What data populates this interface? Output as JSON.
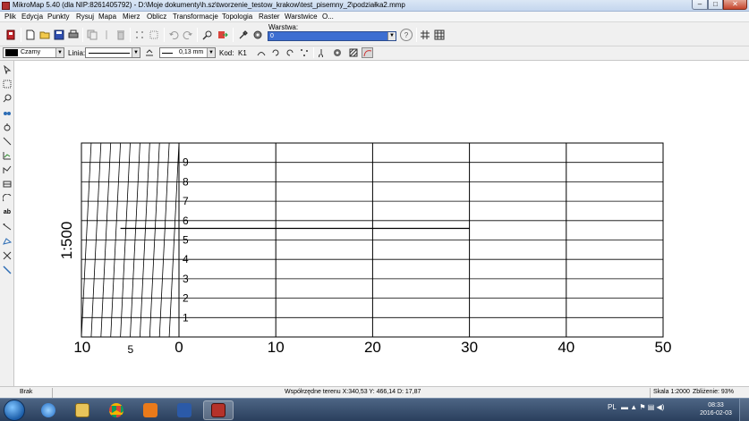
{
  "window": {
    "title": "MikroMap 5.40 (dla NIP:8261405792) - D:\\Moje dokumenty\\h.sz\\tworzenie_testow_krakow\\test_pisemny_2\\podziałka2.mmp",
    "minimize": "–",
    "maximize": "□",
    "close": "✕"
  },
  "menu": [
    "Plik",
    "Edycja",
    "Punkty",
    "Rysuj",
    "Mapa",
    "Mierz",
    "Oblicz",
    "Transformacje",
    "Topologia",
    "Raster",
    "Warstwice",
    "O..."
  ],
  "toolbar": {
    "layer_label": "Warstwa:",
    "layer_value": "0",
    "help_glyph": "?"
  },
  "toolbar2": {
    "color_value": "Czarny",
    "line_label": "Linia:",
    "line_value": "",
    "width_value": "0,13 mm",
    "code_label": "Kod:",
    "code_value": "K1"
  },
  "drawing": {
    "scale_label": "1:500",
    "bottom_labels": [
      {
        "text": "10",
        "value": -10
      },
      {
        "text": "5",
        "value": -5
      },
      {
        "text": "0",
        "value": 0
      },
      {
        "text": "10",
        "value": 10
      },
      {
        "text": "20",
        "value": 20
      },
      {
        "text": "30",
        "value": 30
      },
      {
        "text": "40",
        "value": 40
      },
      {
        "text": "50",
        "value": 50
      }
    ],
    "vertical_labels": [
      "1",
      "2",
      "3",
      "4",
      "5",
      "6",
      "7",
      "8",
      "9"
    ],
    "marker_value": 5.6,
    "marker_to": 30
  },
  "status": {
    "left": "Brak",
    "coords": "Współrzędne terenu X:340,53 Y: 466,14  D: 17,87",
    "scale": "Skala 1:2000",
    "zoom": "Zbliżenie: 93%"
  },
  "taskbar": {
    "lang": "PL",
    "time": "08:33",
    "date": "2016-02-03"
  },
  "colors": {
    "layer_select": "#3d6ed1",
    "taskbar": "#3a5272"
  }
}
